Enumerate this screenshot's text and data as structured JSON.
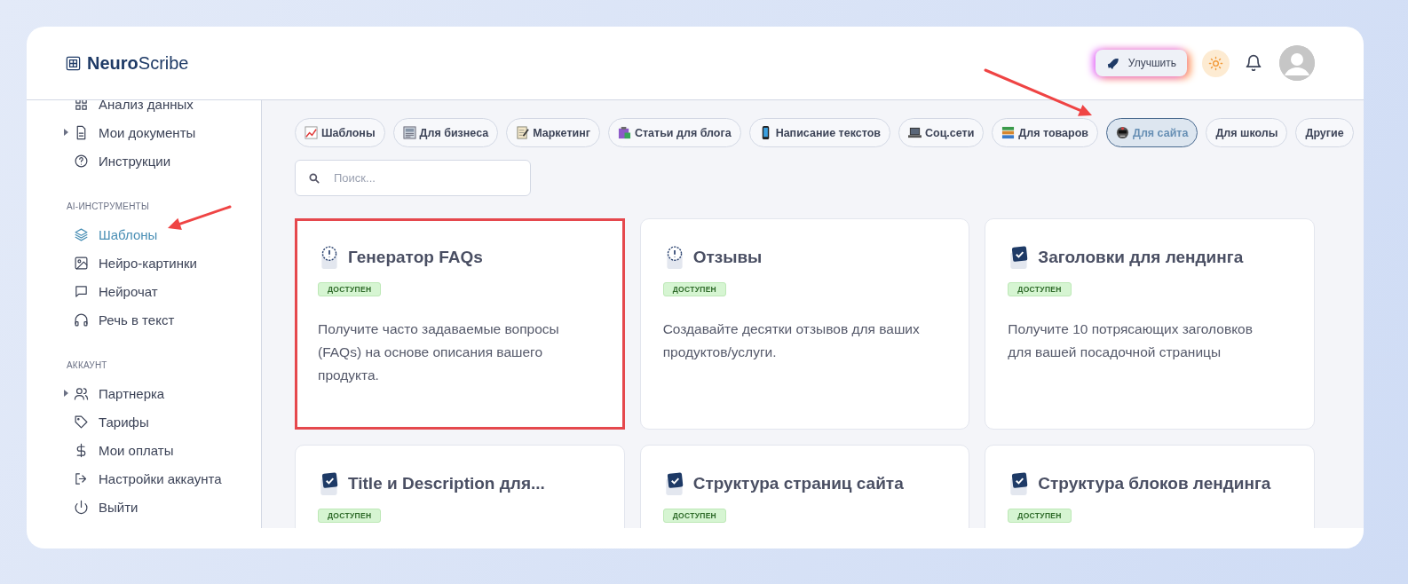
{
  "header": {
    "logo": "**Neuro**Scribe",
    "upgrade_button": "Улучшить"
  },
  "sidebar": {
    "sections": [
      {
        "items": [
          {
            "label": "Анализ данных",
            "kind": "link",
            "selected": false
          },
          {
            "label": "Мои документы",
            "kind": "collapsible",
            "selected": false
          },
          {
            "label": "Инструкции",
            "kind": "link",
            "selected": false
          }
        ]
      },
      {
        "title": "AI-ИНСТРУМЕНТЫ",
        "items": [
          {
            "label": "Шаблоны",
            "kind": "link",
            "selected": true
          },
          {
            "label": "Нейро-картинки",
            "kind": "link",
            "selected": false
          },
          {
            "label": "Нейрочат",
            "kind": "link",
            "selected": false
          },
          {
            "label": "Речь в текст",
            "kind": "link",
            "selected": false
          }
        ]
      },
      {
        "title": "АККАУНТ",
        "items": [
          {
            "label": "Партнерка",
            "kind": "collapsible",
            "selected": false
          },
          {
            "label": "Тарифы",
            "kind": "link",
            "selected": false
          },
          {
            "label": "Мои оплаты",
            "kind": "link",
            "selected": false
          },
          {
            "label": "Настройки аккаунта",
            "kind": "link",
            "selected": false
          },
          {
            "label": "Выйти",
            "kind": "link",
            "selected": false
          }
        ]
      }
    ]
  },
  "categories": [
    {
      "label": "Шаблоны",
      "selected": false
    },
    {
      "label": "Для бизнеса",
      "selected": false
    },
    {
      "label": "Маркетинг",
      "selected": false
    },
    {
      "label": "Статьи для блога",
      "selected": false
    },
    {
      "label": "Написание текстов",
      "selected": false
    },
    {
      "label": "Соц.сети",
      "selected": false
    },
    {
      "label": "Для товаров",
      "selected": false
    },
    {
      "label": "Для сайта",
      "selected": true
    },
    {
      "label": "Для школы",
      "selected": false
    },
    {
      "label": "Другие",
      "selected": false
    }
  ],
  "search": {
    "placeholder": "Поиск..."
  },
  "templates": [
    {
      "title": "Генератор FAQs",
      "badge": "ДОСТУПЕН",
      "description": "Получите часто задаваемые вопросы (FAQs) на основе описания вашего продукта.",
      "highlighted": true
    },
    {
      "title": "Отзывы",
      "badge": "ДОСТУПЕН",
      "description": "Создавайте десятки отзывов для ваших продуктов/услуги.",
      "highlighted": false
    },
    {
      "title": "Заголовки для лендинга",
      "badge": "ДОСТУПЕН",
      "description": "Получите 10 потрясающих заголовков для вашей посадочной страницы",
      "highlighted": false
    },
    {
      "title": "Title и Description для...",
      "badge": "ДОСТУПЕН",
      "highlighted": false
    },
    {
      "title": "Структура страниц сайта",
      "badge": "ДОСТУПЕН",
      "highlighted": false
    },
    {
      "title": "Структура блоков лендинга",
      "badge": "ДОСТУПЕН",
      "highlighted": false
    }
  ]
}
